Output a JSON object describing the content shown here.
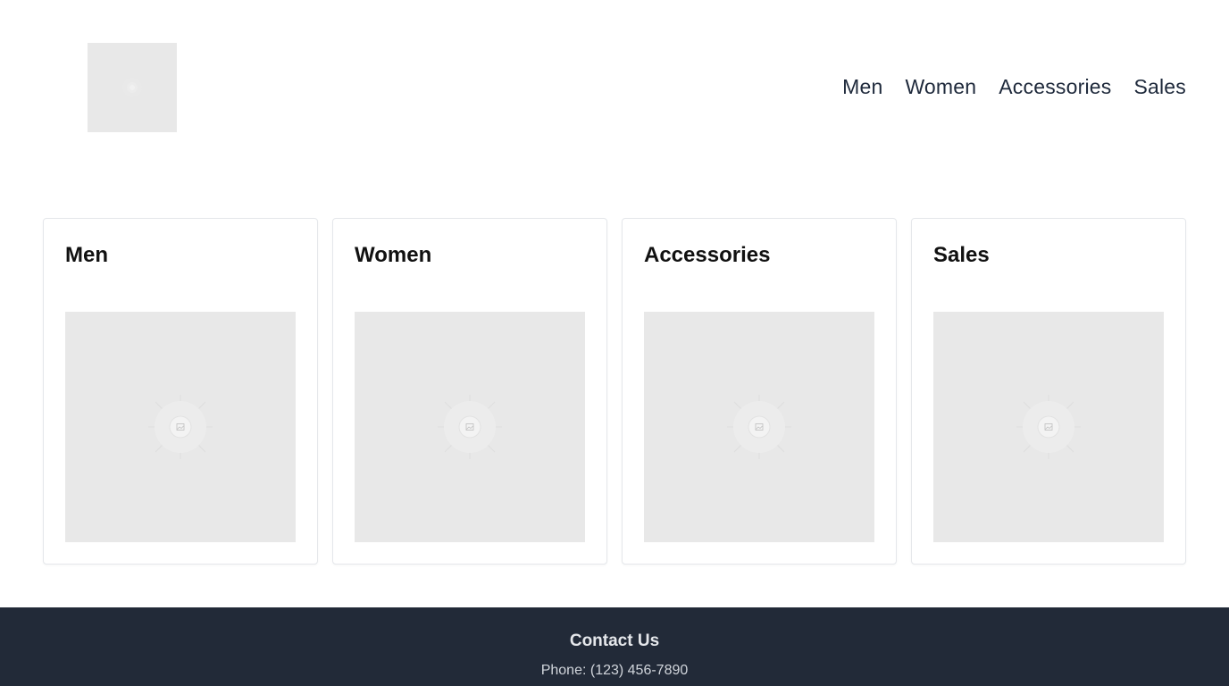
{
  "header": {
    "logo_icon": "image-placeholder-icon",
    "nav": [
      {
        "label": "Men"
      },
      {
        "label": "Women"
      },
      {
        "label": "Accessories"
      },
      {
        "label": "Sales"
      }
    ]
  },
  "cards": [
    {
      "title": "Men",
      "image_icon": "image-placeholder-icon"
    },
    {
      "title": "Women",
      "image_icon": "image-placeholder-icon"
    },
    {
      "title": "Accessories",
      "image_icon": "image-placeholder-icon"
    },
    {
      "title": "Sales",
      "image_icon": "image-placeholder-icon"
    }
  ],
  "footer": {
    "title": "Contact Us",
    "phone": "Phone: (123) 456-7890"
  },
  "colors": {
    "footer_bg": "#222a38",
    "placeholder_bg": "#e8e8e8",
    "nav_text": "#1e293b"
  }
}
